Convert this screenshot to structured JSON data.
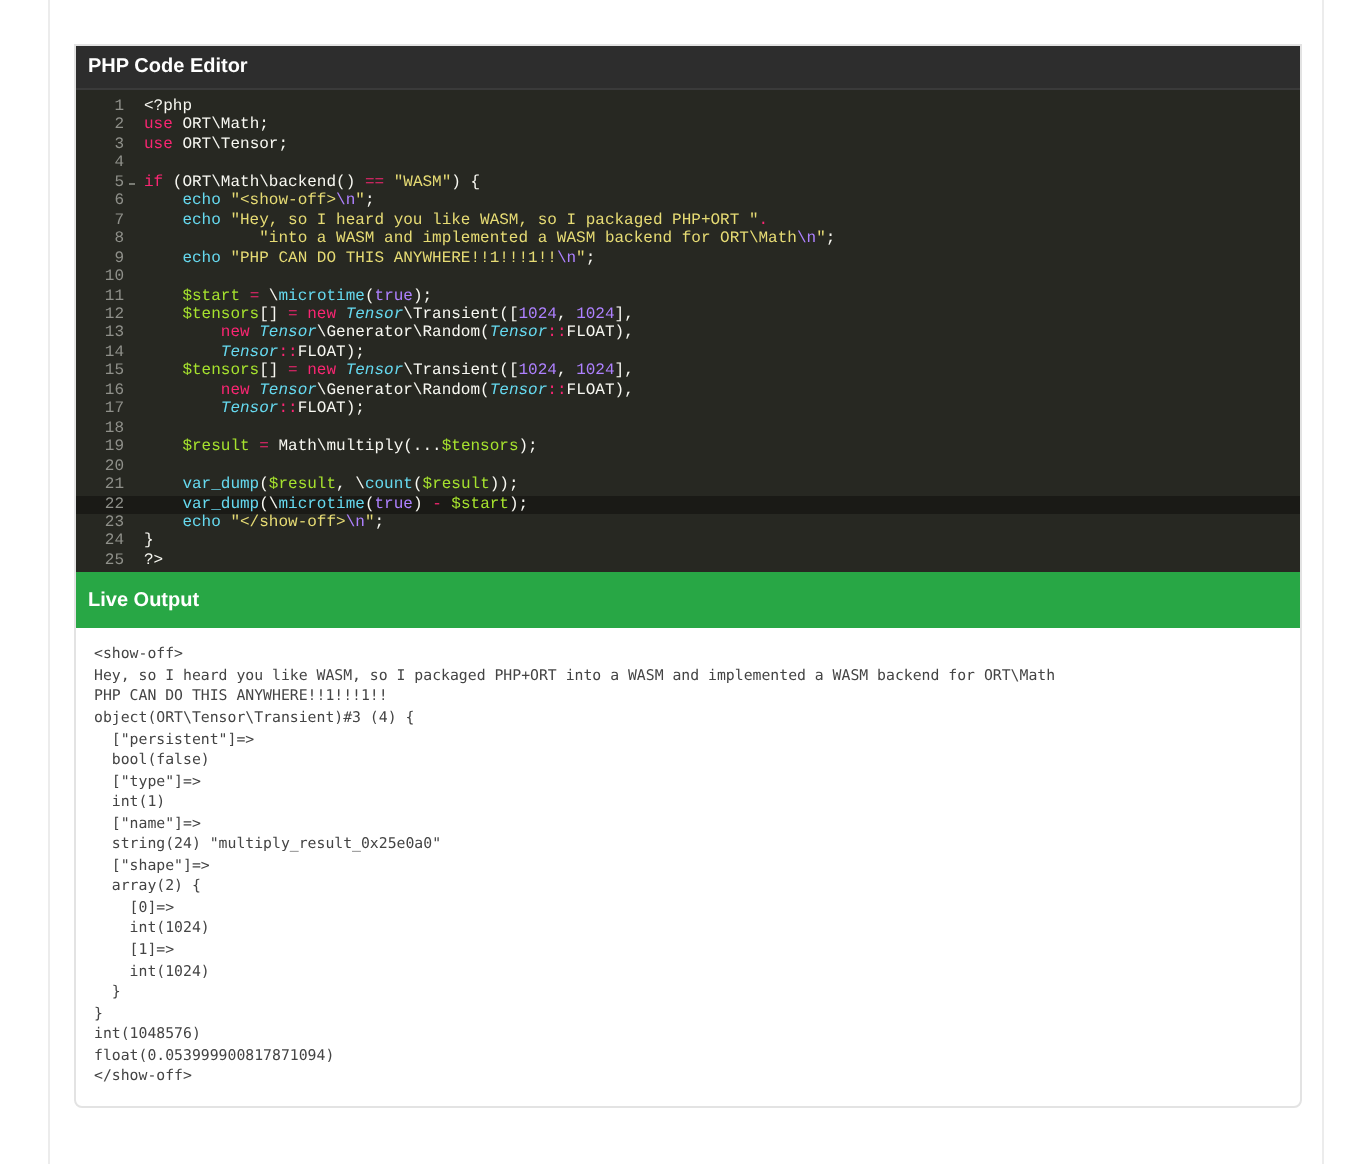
{
  "editor": {
    "title": "PHP Code Editor",
    "lines": [
      {
        "number": "1",
        "foldable": false,
        "selected": false,
        "tokens": [
          {
            "text": "<?php",
            "kind": "plain"
          }
        ]
      },
      {
        "number": "2",
        "foldable": false,
        "selected": false,
        "tokens": [
          {
            "text": "use",
            "kind": "kw"
          },
          {
            "text": " ORT\\Math;",
            "kind": "plain"
          }
        ]
      },
      {
        "number": "3",
        "foldable": false,
        "selected": false,
        "tokens": [
          {
            "text": "use",
            "kind": "kw"
          },
          {
            "text": " ORT\\Tensor;",
            "kind": "plain"
          }
        ]
      },
      {
        "number": "4",
        "foldable": false,
        "selected": false
      },
      {
        "number": "5",
        "foldable": true,
        "selected": false,
        "tokens": [
          {
            "text": "if",
            "kind": "kw"
          },
          {
            "text": " (ORT\\Math\\backend() ",
            "kind": "plain"
          },
          {
            "text": "==",
            "kind": "op"
          },
          {
            "text": " \"WASM\"",
            "kind": "str"
          },
          {
            "text": ") {",
            "kind": "plain"
          }
        ]
      },
      {
        "number": "6",
        "foldable": false,
        "selected": false,
        "tokens": [
          {
            "text": "    echo",
            "kind": "fn"
          },
          {
            "text": " \"<show-off>",
            "kind": "str"
          },
          {
            "text": "\\n",
            "kind": "esc"
          },
          {
            "text": "\"",
            "kind": "str"
          },
          {
            "text": ";",
            "kind": "plain"
          }
        ]
      },
      {
        "number": "7",
        "foldable": false,
        "selected": false,
        "tokens": [
          {
            "text": "    echo",
            "kind": "fn"
          },
          {
            "text": " \"Hey, so I heard you like WASM, so I packaged PHP+ORT \"",
            "kind": "str"
          },
          {
            "text": ".",
            "kind": "op"
          }
        ]
      },
      {
        "number": "8",
        "foldable": false,
        "selected": false,
        "tokens": [
          {
            "text": "            \"into a WASM and implemented a WASM backend for ORT\\Math",
            "kind": "str"
          },
          {
            "text": "\\n",
            "kind": "esc"
          },
          {
            "text": "\"",
            "kind": "str"
          },
          {
            "text": ";",
            "kind": "plain"
          }
        ]
      },
      {
        "number": "9",
        "foldable": false,
        "selected": false,
        "tokens": [
          {
            "text": "    echo",
            "kind": "fn"
          },
          {
            "text": " \"PHP CAN DO THIS ANYWHERE!!1!!!1!!",
            "kind": "str"
          },
          {
            "text": "\\n",
            "kind": "esc"
          },
          {
            "text": "\"",
            "kind": "str"
          },
          {
            "text": ";",
            "kind": "plain"
          }
        ]
      },
      {
        "number": "10",
        "foldable": false,
        "selected": false
      },
      {
        "number": "11",
        "foldable": false,
        "selected": false,
        "tokens": [
          {
            "text": "    $start",
            "kind": "var"
          },
          {
            "text": " =",
            "kind": "op"
          },
          {
            "text": " \\",
            "kind": "plain"
          },
          {
            "text": "microtime",
            "kind": "fn"
          },
          {
            "text": "(",
            "kind": "plain"
          },
          {
            "text": "true",
            "kind": "num"
          },
          {
            "text": ");",
            "kind": "plain"
          }
        ]
      },
      {
        "number": "12",
        "foldable": false,
        "selected": false,
        "tokens": [
          {
            "text": "    $tensors",
            "kind": "var"
          },
          {
            "text": "[] ",
            "kind": "plain"
          },
          {
            "text": "=",
            "kind": "op"
          },
          {
            "text": " new",
            "kind": "kw"
          },
          {
            "text": " Tensor",
            "kind": "cls"
          },
          {
            "text": "\\Transient([",
            "kind": "plain"
          },
          {
            "text": "1024",
            "kind": "num"
          },
          {
            "text": ", ",
            "kind": "plain"
          },
          {
            "text": "1024",
            "kind": "num"
          },
          {
            "text": "],",
            "kind": "plain"
          }
        ]
      },
      {
        "number": "13",
        "foldable": false,
        "selected": false,
        "tokens": [
          {
            "text": "        new",
            "kind": "kw"
          },
          {
            "text": " Tensor",
            "kind": "cls"
          },
          {
            "text": "\\Generator\\Random(",
            "kind": "plain"
          },
          {
            "text": "Tensor",
            "kind": "cls"
          },
          {
            "text": "::",
            "kind": "op"
          },
          {
            "text": "FLOAT),",
            "kind": "plain"
          }
        ]
      },
      {
        "number": "14",
        "foldable": false,
        "selected": false,
        "tokens": [
          {
            "text": "        Tensor",
            "kind": "cls"
          },
          {
            "text": "::",
            "kind": "op"
          },
          {
            "text": "FLOAT);",
            "kind": "plain"
          }
        ]
      },
      {
        "number": "15",
        "foldable": false,
        "selected": false,
        "tokens": [
          {
            "text": "    $tensors",
            "kind": "var"
          },
          {
            "text": "[] ",
            "kind": "plain"
          },
          {
            "text": "=",
            "kind": "op"
          },
          {
            "text": " new",
            "kind": "kw"
          },
          {
            "text": " Tensor",
            "kind": "cls"
          },
          {
            "text": "\\Transient([",
            "kind": "plain"
          },
          {
            "text": "1024",
            "kind": "num"
          },
          {
            "text": ", ",
            "kind": "plain"
          },
          {
            "text": "1024",
            "kind": "num"
          },
          {
            "text": "],",
            "kind": "plain"
          }
        ]
      },
      {
        "number": "16",
        "foldable": false,
        "selected": false,
        "tokens": [
          {
            "text": "        new",
            "kind": "kw"
          },
          {
            "text": " Tensor",
            "kind": "cls"
          },
          {
            "text": "\\Generator\\Random(",
            "kind": "plain"
          },
          {
            "text": "Tensor",
            "kind": "cls"
          },
          {
            "text": "::",
            "kind": "op"
          },
          {
            "text": "FLOAT),",
            "kind": "plain"
          }
        ]
      },
      {
        "number": "17",
        "foldable": false,
        "selected": false,
        "tokens": [
          {
            "text": "        Tensor",
            "kind": "cls"
          },
          {
            "text": "::",
            "kind": "op"
          },
          {
            "text": "FLOAT);",
            "kind": "plain"
          }
        ]
      },
      {
        "number": "18",
        "foldable": false,
        "selected": false
      },
      {
        "number": "19",
        "foldable": false,
        "selected": false,
        "tokens": [
          {
            "text": "    $result",
            "kind": "var"
          },
          {
            "text": " =",
            "kind": "op"
          },
          {
            "text": " Math\\multiply(...",
            "kind": "plain"
          },
          {
            "text": "$tensors",
            "kind": "var"
          },
          {
            "text": ");",
            "kind": "plain"
          }
        ]
      },
      {
        "number": "20",
        "foldable": false,
        "selected": false
      },
      {
        "number": "21",
        "foldable": false,
        "selected": false,
        "tokens": [
          {
            "text": "    var_dump",
            "kind": "fn"
          },
          {
            "text": "(",
            "kind": "plain"
          },
          {
            "text": "$result",
            "kind": "var"
          },
          {
            "text": ", \\",
            "kind": "plain"
          },
          {
            "text": "count",
            "kind": "fn"
          },
          {
            "text": "(",
            "kind": "plain"
          },
          {
            "text": "$result",
            "kind": "var"
          },
          {
            "text": "));",
            "kind": "plain"
          }
        ]
      },
      {
        "number": "22",
        "foldable": false,
        "selected": true,
        "tokens": [
          {
            "text": "    var_dump",
            "kind": "fn"
          },
          {
            "text": "(\\",
            "kind": "plain"
          },
          {
            "text": "microtime",
            "kind": "fn"
          },
          {
            "text": "(",
            "kind": "plain"
          },
          {
            "text": "true",
            "kind": "num"
          },
          {
            "text": ") ",
            "kind": "plain"
          },
          {
            "text": "-",
            "kind": "op"
          },
          {
            "text": " $start",
            "kind": "var"
          },
          {
            "text": ");",
            "kind": "plain"
          }
        ]
      },
      {
        "number": "23",
        "foldable": false,
        "selected": false,
        "tokens": [
          {
            "text": "    echo",
            "kind": "fn"
          },
          {
            "text": " \"</show-off>",
            "kind": "str"
          },
          {
            "text": "\\n",
            "kind": "esc"
          },
          {
            "text": "\"",
            "kind": "str"
          },
          {
            "text": ";",
            "kind": "plain"
          }
        ]
      },
      {
        "number": "24",
        "foldable": false,
        "selected": false,
        "tokens": [
          {
            "text": "}",
            "kind": "plain"
          }
        ]
      },
      {
        "number": "25",
        "foldable": false,
        "selected": false,
        "tokens": [
          {
            "text": "?>",
            "kind": "plain"
          }
        ]
      }
    ]
  },
  "output": {
    "title": "Live Output",
    "lines": [
      "<show-off>",
      "Hey, so I heard you like WASM, so I packaged PHP+ORT into a WASM and implemented a WASM backend for ORT\\Math",
      "PHP CAN DO THIS ANYWHERE!!1!!!1!!",
      "object(ORT\\Tensor\\Transient)#3 (4) {",
      "  [\"persistent\"]=>",
      "  bool(false)",
      "  [\"type\"]=>",
      "  int(1)",
      "  [\"name\"]=>",
      "  string(24) \"multiply_result_0x25e0a0\"",
      "  [\"shape\"]=>",
      "  array(2) {",
      "    [0]=>",
      "    int(1024)",
      "    [1]=>",
      "    int(1024)",
      "  }",
      "}",
      "int(1048576)",
      "float(0.053999900817871094)",
      "</show-off>"
    ]
  }
}
